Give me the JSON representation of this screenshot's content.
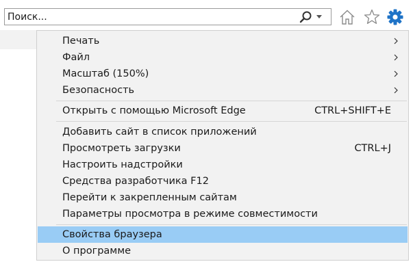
{
  "toolbar": {
    "search_placeholder": "Поиск...",
    "icons": [
      "search-icon",
      "chevron-down-icon",
      "home-icon",
      "star-icon",
      "gear-icon"
    ],
    "gear_color": "#1e73c7"
  },
  "menu": {
    "groups": [
      [
        {
          "label": "Печать",
          "submenu": true
        },
        {
          "label": "Файл",
          "submenu": true
        },
        {
          "label": "Масштаб (150%)",
          "submenu": true
        },
        {
          "label": "Безопасность",
          "submenu": true
        }
      ],
      [
        {
          "label": "Открыть с помощью Microsoft Edge",
          "shortcut": "CTRL+SHIFT+E"
        }
      ],
      [
        {
          "label": "Добавить сайт в список приложений"
        },
        {
          "label": "Просмотреть загрузки",
          "shortcut": "CTRL+J"
        },
        {
          "label": "Настроить надстройки"
        },
        {
          "label": "Средства разработчика F12"
        },
        {
          "label": "Перейти к закрепленным сайтам"
        },
        {
          "label": "Параметры просмотра в режиме совместимости"
        }
      ],
      [
        {
          "label": "Свойства браузера",
          "selected": true
        },
        {
          "label": "О программе"
        }
      ]
    ],
    "highlight_color": "#99ccf5"
  }
}
